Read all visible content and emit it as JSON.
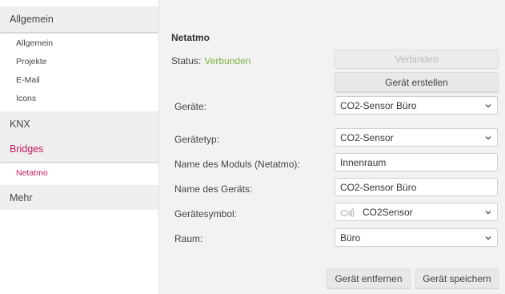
{
  "sidebar": {
    "sections": [
      {
        "label": "Allgemein"
      },
      {
        "label": "KNX"
      },
      {
        "label": "Bridges"
      },
      {
        "label": "Mehr"
      }
    ],
    "allgemein_items": [
      {
        "label": "Allgemein"
      },
      {
        "label": "Projekte"
      },
      {
        "label": "E-Mail"
      },
      {
        "label": "Icons"
      }
    ],
    "bridges_items": [
      {
        "label": "Netatmo"
      }
    ]
  },
  "main": {
    "title": "Netatmo",
    "status_label": "Status:",
    "status_value": "Verbunden",
    "connect_button": "Verbinden",
    "create_device_button": "Gerät erstellen",
    "fields": {
      "devices": {
        "label": "Geräte:",
        "value": "CO2-Sensor Büro"
      },
      "device_type": {
        "label": "Gerätetyp:",
        "value": "CO2-Sensor"
      },
      "module_name": {
        "label": "Name des Moduls (Netatmo):",
        "value": "Innenraum"
      },
      "device_name": {
        "label": "Name des Geräts:",
        "value": "CO2-Sensor Büro"
      },
      "device_symbol": {
        "label": "Gerätesymbol:",
        "value": "CO2Sensor",
        "icon": "co2-sensor-icon"
      },
      "room": {
        "label": "Raum:",
        "value": "Büro"
      }
    },
    "remove_button": "Gerät entfernen",
    "save_button": "Gerät speichern"
  },
  "colors": {
    "accent": "#c2185b",
    "status_ok": "#7cb342",
    "panel_bg": "#f2f2f2",
    "section_bg": "#efefef"
  }
}
